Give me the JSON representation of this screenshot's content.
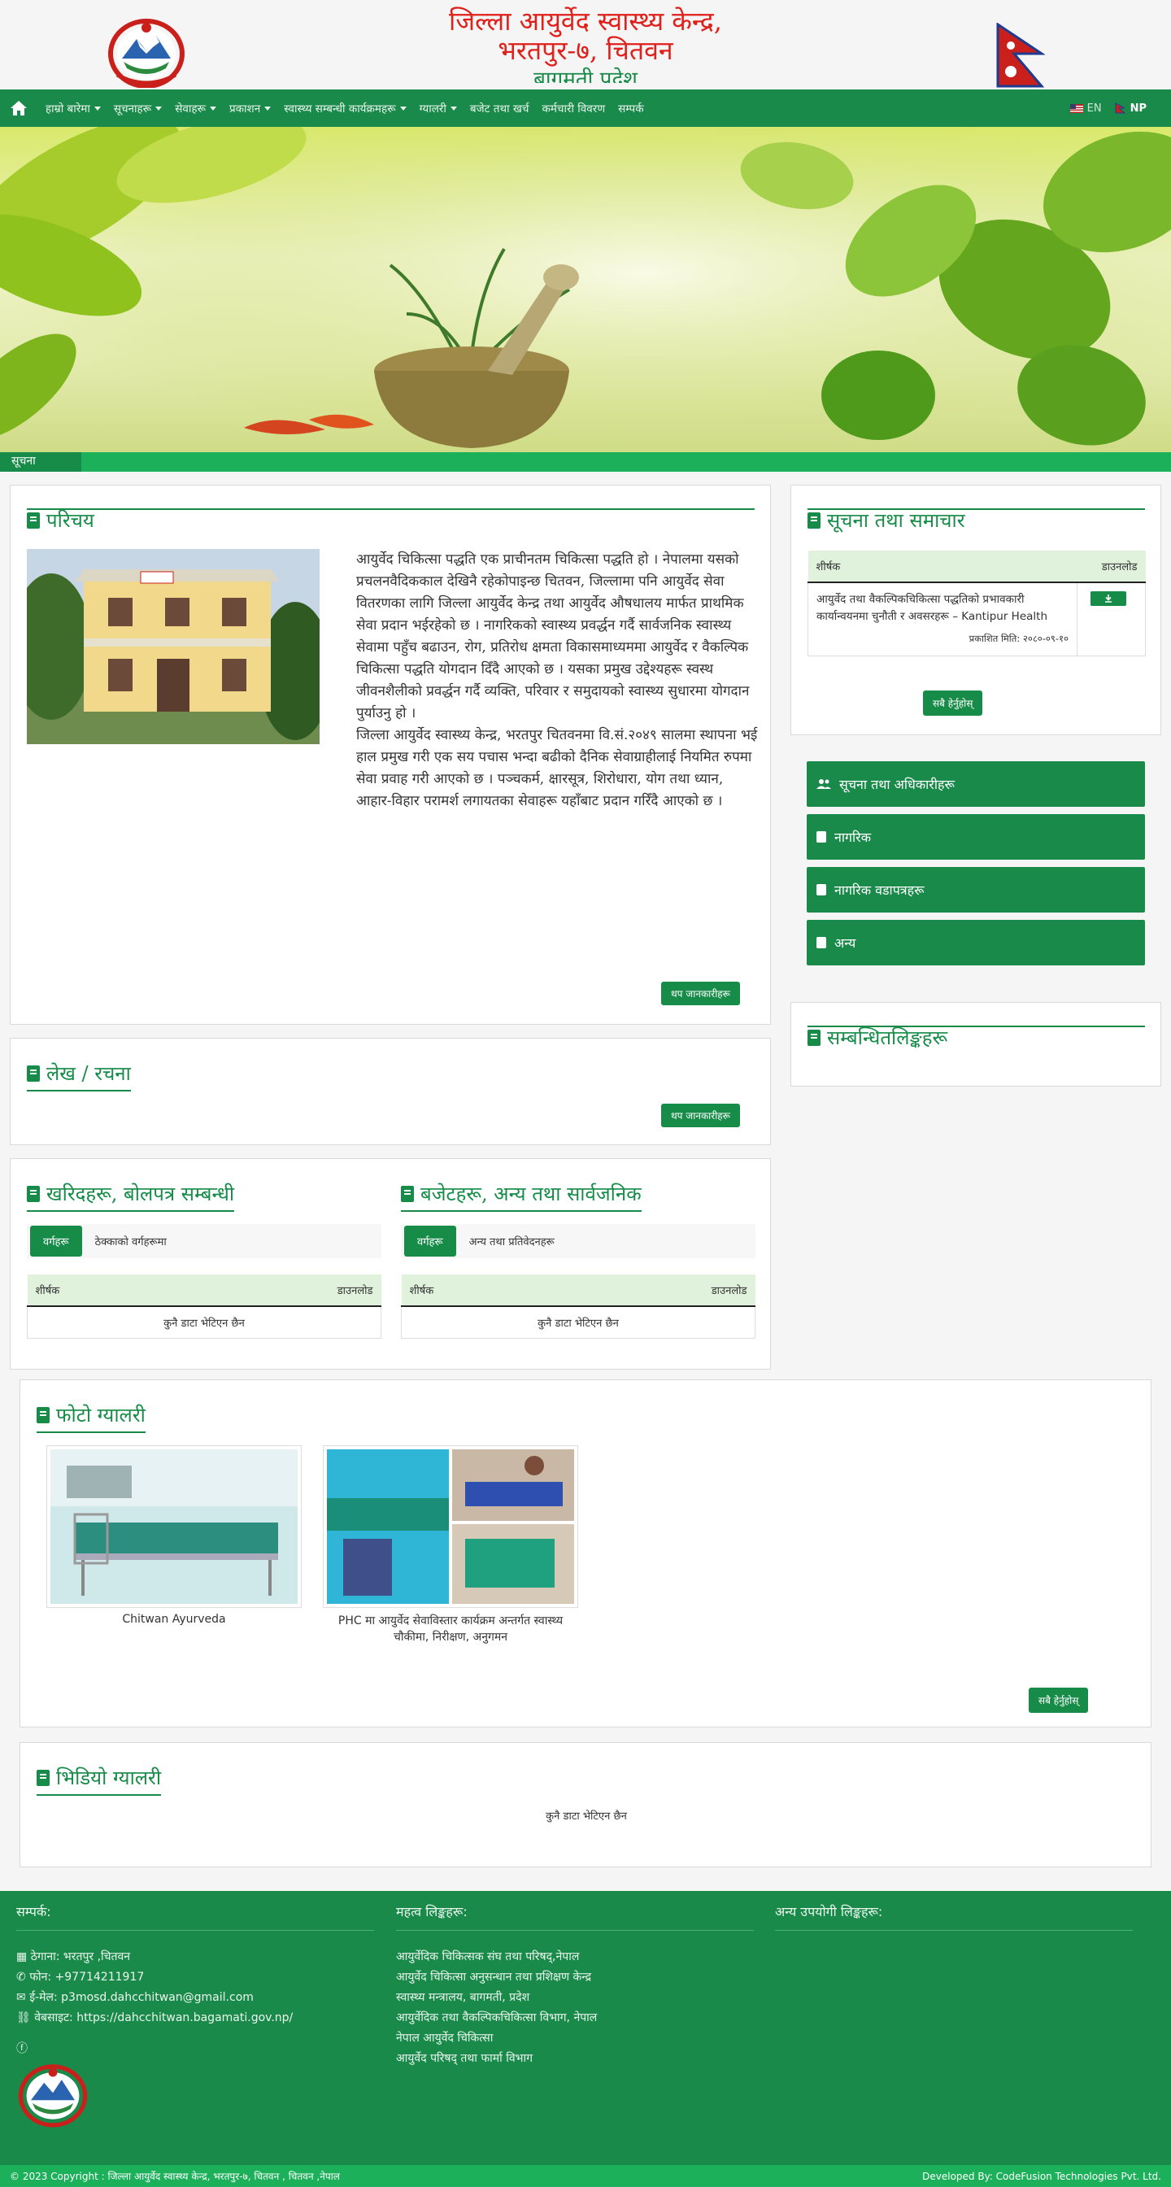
{
  "header": {
    "title_line1": "जिल्ला आयुर्वेद स्वास्थ्य केन्द्र,",
    "title_line2": "भरतपुर-७, चितवन",
    "title_line3": "बागमती प्रदेश"
  },
  "nav": {
    "items": [
      {
        "label": "हाम्रो बारेमा",
        "dropdown": true
      },
      {
        "label": "सूचनाहरू",
        "dropdown": true
      },
      {
        "label": "सेवाहरू",
        "dropdown": true
      },
      {
        "label": "प्रकाशन",
        "dropdown": true
      },
      {
        "label": "स्वास्थ्य सम्बन्धी कार्यक्रमहरू",
        "dropdown": true
      },
      {
        "label": "ग्यालरी",
        "dropdown": true
      },
      {
        "label": "बजेट तथा खर्च"
      },
      {
        "label": "कर्मचारी विवरण"
      },
      {
        "label": "सम्पर्क"
      }
    ],
    "lang_en": "EN",
    "lang_np": "NP"
  },
  "ticker": {
    "label": "सूचना"
  },
  "about": {
    "title": "परिचय",
    "text": "आयुर्वेद चिकित्सा पद्धति एक प्राचीनतम चिकित्सा पद्धति हो । नेपालमा यसको प्रचलनवैदिककाल देखिनै रहेकोपाइन्छ चितवन, जिल्लामा पनि आयुर्वेद सेवा वितरणका लागि जिल्ला आयुर्वेद केन्द्र तथा आयुर्वेद औषधालय मार्फत प्राथमिक सेवा प्रदान भईरहेको छ । नागरिकको स्वास्थ्य प्रवर्द्धन गर्दै सार्वजनिक स्वास्थ्य सेवामा पहुँच बढाउन, रोग, प्रतिरोध क्षमता विकासमाध्यममा आयुर्वेद र वैकल्पिक चिकित्सा पद्धति योगदान दिँदै आएको छ । यसका प्रमुख उद्देश्यहरू स्वस्थ जीवनशैलीको प्रवर्द्धन गर्दै व्यक्ति, परिवार र समुदायको स्वास्थ्य सुधारमा योगदान पुर्याउनु हो ।\nजिल्ला आयुर्वेद स्वास्थ्य केन्द्र, भरतपुर चितवनमा वि.सं.२०४९ सालमा स्थापना भई हाल प्रमुख गरी एक सय पचास भन्दा बढीको दैनिक सेवाग्राहीलाई नियमित रुपमा सेवा प्रवाह गरी आएको छ । पञ्चकर्म, क्षारसूत्र, शिरोधारा, योग तथा ध्यान, आहार-विहार परामर्श लगायतका सेवाहरू यहाँबाट प्रदान गरिँदै आएको छ ।",
    "more": "थप जानकारीहरू"
  },
  "notices": {
    "title": "सूचना तथा समाचार",
    "col_title": "शीर्षक",
    "col_download": "डाउनलोड",
    "row_title": "आयुर्वेद तथा वैकल्पिकचिकित्सा पद्धतिको प्रभावकारी कार्यान्वयनमा चुनौती र अवसरहरू – Kantipur Health",
    "row_date": "प्रकाशित मिति: २०८०-०९-१०",
    "more": "सबै हेर्नुहोस्"
  },
  "side_links": [
    {
      "label": "सूचना तथा अधिकारीहरू",
      "icon": "users-icon"
    },
    {
      "label": "नागरिक",
      "icon": "book-icon"
    },
    {
      "label": "नागरिक वडापत्रहरू",
      "icon": "book-icon"
    },
    {
      "label": "अन्य",
      "icon": "book-icon"
    }
  ],
  "important_links": {
    "title": "सम्बन्धितलिङ्कहरू"
  },
  "news": {
    "title": "लेख / रचना",
    "more": "थप जानकारीहरू"
  },
  "tenders": {
    "title": "खरिदहरू, बोलपत्र सम्बन्धी",
    "filter_btn": "वर्गहरू",
    "filter_text": "ठेक्काको वर्गहरूमा",
    "col_title": "शीर्षक",
    "col_download": "डाउनलोड",
    "empty": "कुनै डाटा भेटिएन छैन"
  },
  "reports": {
    "title": "बजेटहरू, अन्य तथा सार्वजनिक",
    "filter_btn": "वर्गहरू",
    "filter_text": "अन्य तथा प्रतिवेदनहरू",
    "col_title": "शीर्षक",
    "col_download": "डाउनलोड",
    "empty": "कुनै डाटा भेटिएन छैन"
  },
  "gallery": {
    "title": "फोटो ग्यालरी",
    "items": [
      {
        "caption": "Chitwan Ayurveda"
      },
      {
        "caption": "PHC मा आयुर्वेद सेवाविस्तार कार्यक्रम अन्तर्गत स्वास्थ्य चौकीमा, निरीक्षण, अनुगमन"
      }
    ],
    "more": "सबै हेर्नुहोस्"
  },
  "videos": {
    "title": "भिडियो ग्यालरी",
    "empty": "कुनै डाटा भेटिएन छैन"
  },
  "footer": {
    "contact_title": "सम्पर्क:",
    "address": "ठेगाना: भरतपुर ,चितवन",
    "phone": "फोन: +97714211917",
    "email": "ई-मेल: p3mosd.dahcchitwan@gmail.com",
    "website": "वेबसाइट: https://dahcchitwan.bagamati.gov.np/",
    "links_title": "महत्व लिङ्कहरू:",
    "links": [
      "आयुर्वेदिक चिकित्सक संघ तथा परिषद्,नेपाल",
      "आयुर्वेद चिकित्सा अनुसन्धान तथा प्रशिक्षण केन्द्र",
      "स्वास्थ्य मन्त्रालय, बागमती, प्रदेश",
      "आयुर्वेदिक तथा वैकल्पिकचिकित्सा विभाग, नेपाल",
      "नेपाल आयुर्वेद चिकित्सा",
      "आयुर्वेद परिषद् तथा फार्मा विभाग"
    ],
    "other_title": "अन्य उपयोगी लिङ्कहरू:",
    "copyright": "© 2023 Copyright : जिल्ला आयुर्वेद स्वास्थ्य केन्द्र, भरतपुर-७, चितवन , चितवन ,नेपाल",
    "developer": "Developed By: CodeFusion Technologies Pvt. Ltd."
  }
}
